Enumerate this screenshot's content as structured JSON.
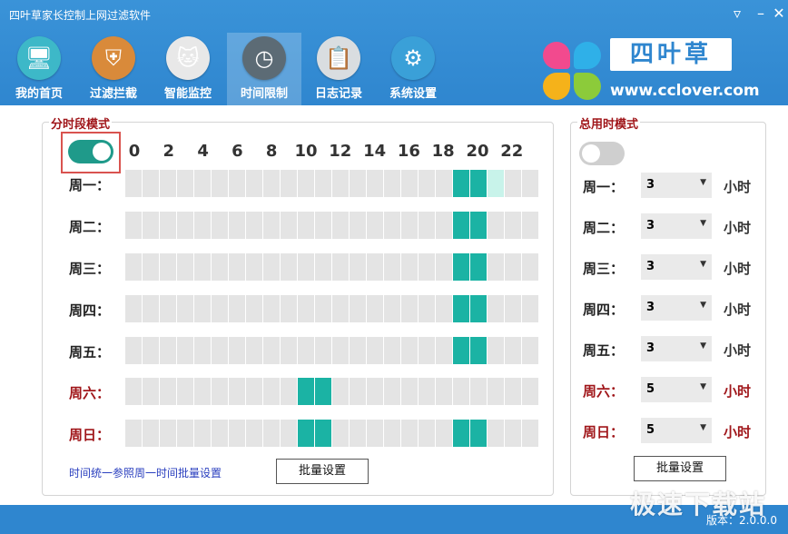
{
  "window": {
    "title": "四叶草家长控制上网过滤软件"
  },
  "nav": [
    {
      "label": "我的首页",
      "icon": "monitor-icon"
    },
    {
      "label": "过滤拦截",
      "icon": "shield-icon"
    },
    {
      "label": "智能监控",
      "icon": "cat-face-icon"
    },
    {
      "label": "时间限制",
      "icon": "clock-icon",
      "active": true
    },
    {
      "label": "日志记录",
      "icon": "clipboard-icon"
    },
    {
      "label": "系统设置",
      "icon": "gear-icon"
    }
  ],
  "brand": {
    "name": "四叶草",
    "url": "www.cclover.com"
  },
  "segment_mode": {
    "title": "分时段模式",
    "enabled": true,
    "hours": [
      "0",
      "2",
      "4",
      "6",
      "8",
      "10",
      "12",
      "14",
      "16",
      "18",
      "20",
      "22"
    ],
    "days": [
      {
        "label": "周一：",
        "weekend": false,
        "on": [
          19,
          20
        ],
        "partial": [
          21
        ]
      },
      {
        "label": "周二：",
        "weekend": false,
        "on": [
          19,
          20
        ],
        "partial": []
      },
      {
        "label": "周三：",
        "weekend": false,
        "on": [
          19,
          20
        ],
        "partial": []
      },
      {
        "label": "周四：",
        "weekend": false,
        "on": [
          19,
          20
        ],
        "partial": []
      },
      {
        "label": "周五：",
        "weekend": false,
        "on": [
          19,
          20
        ],
        "partial": []
      },
      {
        "label": "周六：",
        "weekend": true,
        "on": [
          10,
          11
        ],
        "partial": []
      },
      {
        "label": "周日：",
        "weekend": true,
        "on": [
          10,
          11,
          19,
          20
        ],
        "partial": []
      }
    ],
    "note": "时间统一参照周一时间批量设置",
    "batch_label": "批量设置"
  },
  "total_mode": {
    "title": "总用时模式",
    "enabled": false,
    "rows": [
      {
        "label": "周一：",
        "value": "3",
        "unit": "小时",
        "weekend": false
      },
      {
        "label": "周二：",
        "value": "3",
        "unit": "小时",
        "weekend": false
      },
      {
        "label": "周三：",
        "value": "3",
        "unit": "小时",
        "weekend": false
      },
      {
        "label": "周四：",
        "value": "3",
        "unit": "小时",
        "weekend": false
      },
      {
        "label": "周五：",
        "value": "3",
        "unit": "小时",
        "weekend": false
      },
      {
        "label": "周六：",
        "value": "5",
        "unit": "小时",
        "weekend": true
      },
      {
        "label": "周日：",
        "value": "5",
        "unit": "小时",
        "weekend": true
      }
    ],
    "batch_label": "批量设置"
  },
  "footer": {
    "version": "版本：2.0.0.0",
    "watermark": "极速下载站"
  },
  "colors": {
    "accent": "#2f86cf",
    "on_cell": "#1bb3a4",
    "weekend": "#a0161a"
  }
}
